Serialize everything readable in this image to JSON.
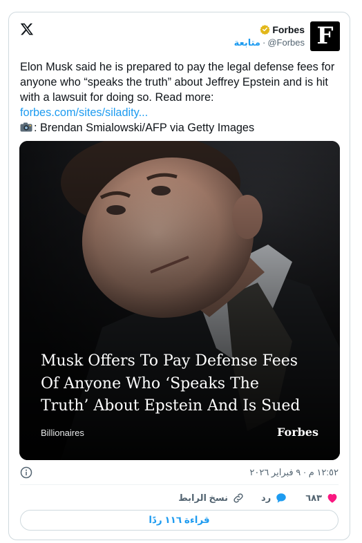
{
  "author": {
    "name": "Forbes",
    "handle": "@Forbes",
    "separator": "·",
    "follow_label": "متابعة",
    "avatar_letter": "F"
  },
  "tweet": {
    "text_main": "Elon Musk said he is prepared to pay the legal defense fees for anyone who “speaks the truth” about Jeffrey Epstein and is hit with a lawsuit for doing so. Read more:",
    "link": "forbes.com/sites/siladity...",
    "photo_credit": ": Brendan Smialowski/AFP via Getty Images"
  },
  "media": {
    "headline_lines": [
      "Musk Offers To Pay Defense Fees",
      "Of Anyone Who ‘Speaks The",
      "Truth’ About Epstein And Is Sued"
    ],
    "category": "Billionaires",
    "brand": "Forbes"
  },
  "timestamp": "١٢:٥٢ م · ٩ فبراير ٢٠٢٦",
  "actions": {
    "like_count": "٦٨٣",
    "reply_label": "رد",
    "copy_link_label": "نسخ الرابط"
  },
  "read_replies_label": "قراءة ١١٦ ردًا",
  "colors": {
    "accent": "#1d9bf0",
    "like": "#f91880",
    "verified": "#e2b719",
    "text": "#0f1419",
    "muted": "#536471"
  }
}
